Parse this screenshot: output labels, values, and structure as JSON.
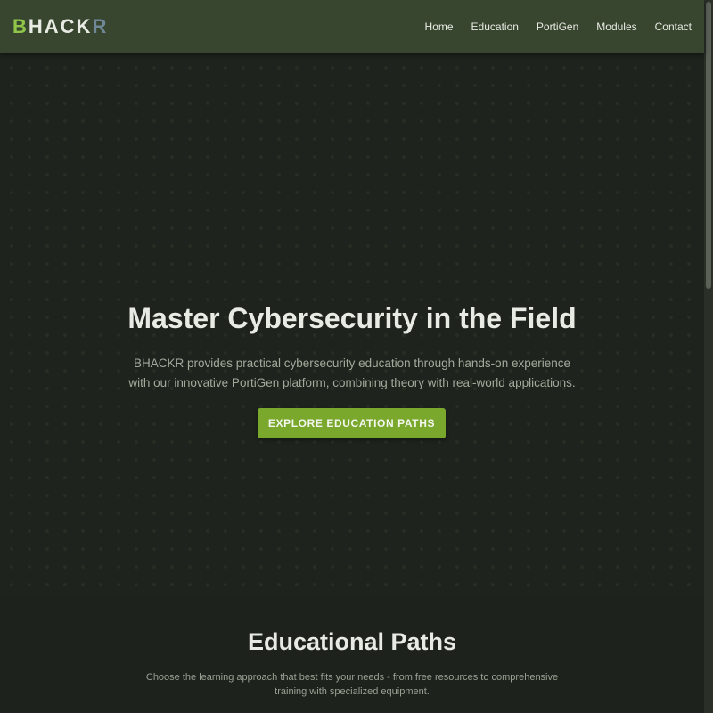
{
  "header": {
    "logo": {
      "first": "B",
      "middle": "HACK",
      "last": "R"
    },
    "nav": [
      "Home",
      "Education",
      "PortiGen",
      "Modules",
      "Contact"
    ]
  },
  "hero": {
    "title": "Master Cybersecurity in the Field",
    "subtitle": "BHACKR provides practical cybersecurity education through hands-on experience with our innovative PortiGen platform, combining theory with real-world applications.",
    "cta_label": "EXPLORE EDUCATION PATHS"
  },
  "education": {
    "title": "Educational Paths",
    "subtitle": "Choose the learning approach that best fits your needs - from free resources to comprehensive training with specialized equipment."
  },
  "colors": {
    "header_bg": "#38452f",
    "page_bg": "#1d221c",
    "accent": "#79a82c",
    "logo_green": "#8fc64a",
    "logo_slate": "#6f8796"
  }
}
